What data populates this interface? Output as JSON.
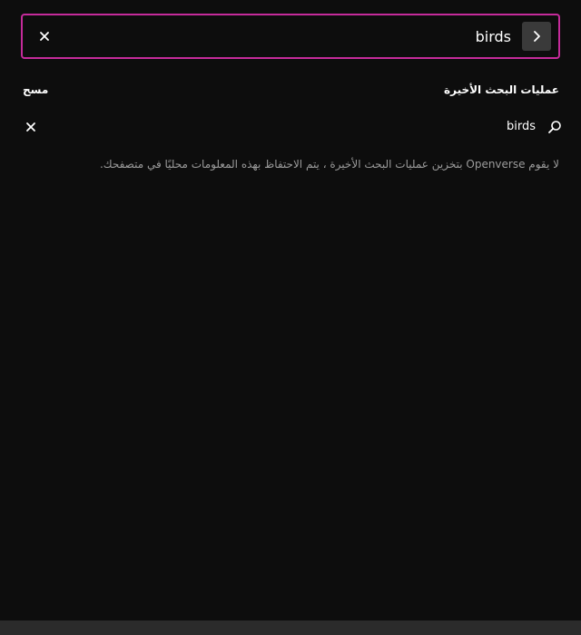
{
  "search": {
    "value": "birds",
    "submit_icon": "chevron-right-icon",
    "clear_icon": "close-icon"
  },
  "recent": {
    "heading": "عمليات البحث الأخيرة",
    "clear_label": "مسح",
    "items": [
      {
        "term": "birds",
        "icon": "search-icon",
        "remove_icon": "close-icon"
      }
    ]
  },
  "notice": {
    "text": "لا يقوم Openverse بتخزين عمليات البحث الأخيرة ، يتم الاحتفاظ بهذه المعلومات محليًا في متصفحك."
  },
  "colors": {
    "background": "#0d0d0d",
    "accent_border": "#c52b9b",
    "button_bg": "#3a3a3a",
    "muted_text": "#9b9b9b"
  }
}
